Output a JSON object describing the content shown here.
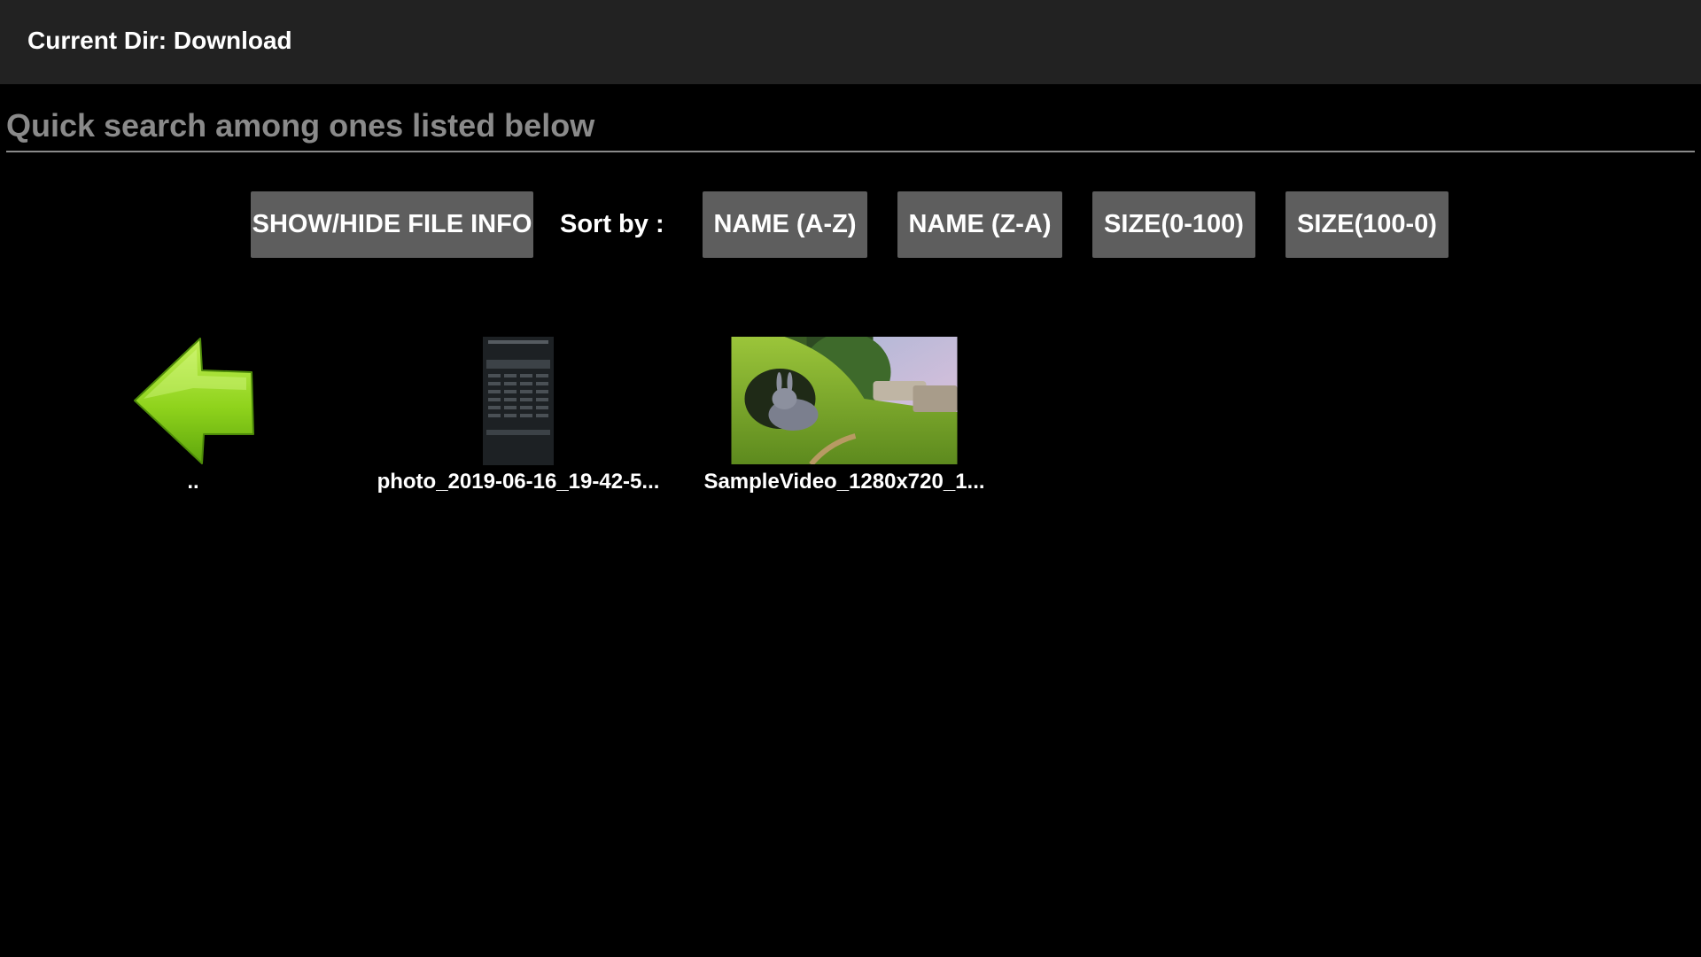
{
  "header": {
    "title": "Current Dir: Download"
  },
  "search": {
    "placeholder": "Quick search among ones listed below"
  },
  "toolbar": {
    "show_hide_label": "SHOW/HIDE FILE INFO",
    "sort_label": "Sort by :",
    "sort_name_asc": "NAME (A-Z)",
    "sort_name_desc": "NAME (Z-A)",
    "sort_size_asc": "SIZE(0-100)",
    "sort_size_desc": "SIZE(100-0)"
  },
  "files": [
    {
      "name": "..",
      "icon": "back-arrow-icon"
    },
    {
      "name": "photo_2019-06-16_19-42-5...",
      "icon": "image-thumbnail"
    },
    {
      "name": "SampleVideo_1280x720_1...",
      "icon": "video-thumbnail"
    }
  ],
  "colors": {
    "titlebar_bg": "#222222",
    "button_bg": "#5e5e5e",
    "arrow_green": "#8fd31c",
    "placeholder_gray": "#8a8a8a"
  }
}
